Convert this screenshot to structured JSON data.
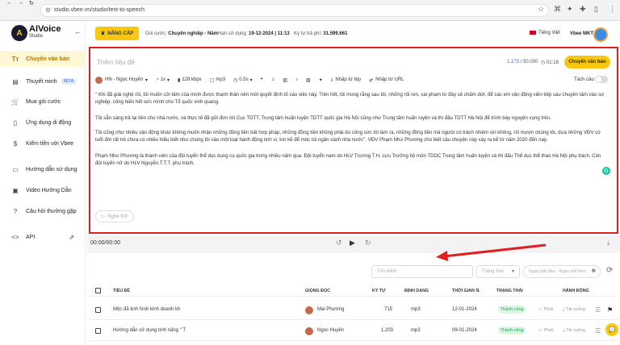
{
  "browser": {
    "url": "studio.vbee.vn/studio/text-to-speech"
  },
  "sidebar": {
    "logo_title": "AIVoice",
    "logo_sub": "Studio",
    "items": [
      {
        "label": "Chuyển văn bản"
      },
      {
        "label": "Thuyết minh",
        "badge": "BETA"
      },
      {
        "label": "Mua gói cước"
      },
      {
        "label": "Ứng dụng di động"
      },
      {
        "label": "Kiếm tiền với Vbee"
      },
      {
        "label": "Hướng dẫn sử dụng"
      },
      {
        "label": "Video Hướng Dẫn"
      },
      {
        "label": "Câu hỏi thường gặp"
      },
      {
        "label": "API"
      }
    ]
  },
  "header": {
    "upgrade_label": "NÂNG CẤP",
    "plan_label": "Gói cước:",
    "plan_value": "Chuyên nghiệp - Năm",
    "expiry_label": "Hạn sử dụng:",
    "expiry_value": "19-12-2024 | 11:13",
    "credits_label": "Ký tự trả phí:",
    "credits_value": "31.599.661",
    "language": "Tiếng Việt",
    "user": "Vbee MKT"
  },
  "editor": {
    "title_placeholder": "Thêm tiêu đề",
    "char_count": "1.173",
    "char_limit": "/ 50.000",
    "duration": "01:16",
    "convert_label": "Chuyển văn bản",
    "toolbar": {
      "voice": "HN - Ngọc Huyền",
      "speed": "1x",
      "bitrate": "128 kbps",
      "format": "mp3",
      "pause": "0.5s",
      "import_file": "Nhập từ tệp",
      "import_url": "Nhập từ URL",
      "split_label": "Tách câu"
    },
    "paragraphs": [
      "\" Khi đã giải nghệ rồi, tôi muốn cởi tâm của mình được thanh thản nên mới quyết định tố cáo việc này. Trên hết, tôi mong rằng sau tôi, những rối ren, sai phạm từ đây sẽ chấm dứt, để các em vận động viên tiếp sau chuyên tâm vào sự nghiệp, cống hiến hết sức mình cho Tổ quốc vinh quang.",
      "Tôi sẵn sàng trả lại tiền cho nhà nước, và thực tế đã gửi đơn tới Cục TDTT, Trung tâm huấn luyện TDTT quốc gia Hà Nội cũng như Trung tâm huấn luyện và thi đấu TDTT Hà Nội để trình bày nguyện vọng trên.",
      "Tôi cũng như nhiều vận động khác không muốn nhận những đồng tiền bất hợp pháp, những đồng tiền không phải do công sức tôi làm ra, những đồng tiền mà người có trách nhiệm xin không, rồi mượn chúng tôi, dựa những VĐV có tuổi đời rất trẻ chưa có nhiều hiểu biết như chúng tôi vào một loạt hành động tinh vi, kín kẽ để móc túi ngân sách nhà nước\". VĐV Phạm Như Phương cho biết câu chuyện này xảy ra kể từ năm 2020 đến nay.",
      "Phạm Như Phương là thành viên của đội tuyển thể dục dụng cụ quốc gia trong nhiều năm qua. Đội tuyển nam do HLV Trương T.H, cựu Trưởng bộ môn TDDC Trung tâm huấn luyện và thi đấu Thể dục thể thao Hà Nội phụ trách. Còn đội tuyển nữ do HLV Nguyễn.T.T.T. phụ trách."
    ],
    "listen_label": "Nghe thử"
  },
  "player": {
    "time": "00:00/00:00"
  },
  "filters": {
    "search_placeholder": "Tìm kiếm",
    "status_placeholder": "Trạng thái",
    "date_placeholder": "Ngày bắt đầu - Ngày kết thúc"
  },
  "table": {
    "headers": [
      "TIÊU ĐỀ",
      "GIỌNG ĐỌC",
      "KÝ TỰ",
      "ĐỊNH DẠNG",
      "THỜI GIAN",
      "TRẠNG THÁI",
      "HÀNH ĐỘNG"
    ],
    "rows": [
      {
        "title": "Mộc đã tinh hình kinh doanh kh",
        "voice": "Mai Phương",
        "chars": "715",
        "format": "mp3",
        "time": "12-01-2024",
        "status": "Thành công",
        "play": "Phát",
        "download": "Tải xuống"
      },
      {
        "title": "Hướng dẫn sử dụng tính năng \" T",
        "voice": "Ngọc Huyền",
        "chars": "1.203",
        "format": "mp3",
        "time": "09-01-2024",
        "status": "Thành công",
        "play": "Phát",
        "download": "Tải xuống"
      }
    ]
  },
  "colors": {
    "accent": "#f9c80e",
    "highlight": "#e02020",
    "success": "#23a455"
  }
}
